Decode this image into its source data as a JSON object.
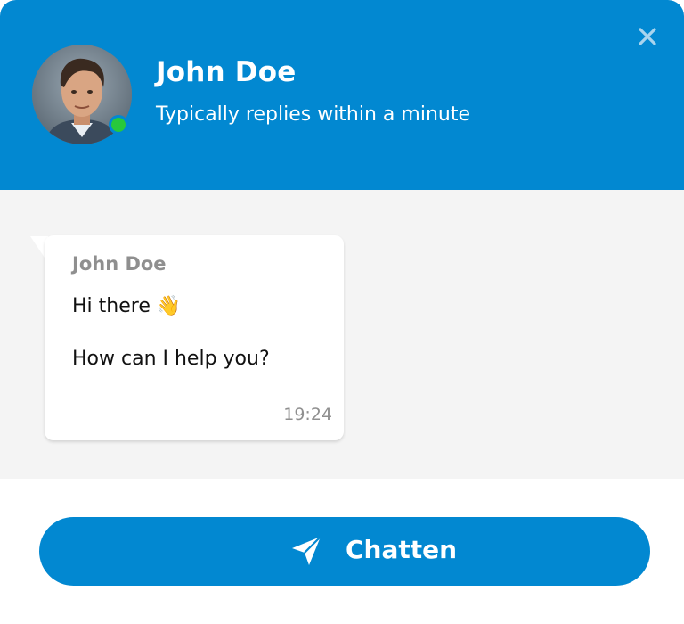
{
  "header": {
    "agent_name": "John Doe",
    "agent_status": "Typically replies within a minute",
    "online": true,
    "avatar_icon": "user-avatar-photo",
    "close_icon": "close-icon"
  },
  "messages": [
    {
      "author": "John Doe",
      "line1": "Hi there 👋",
      "line2": "How can I help you?",
      "time": "19:24"
    }
  ],
  "footer": {
    "button_label": "Chatten",
    "button_icon": "send-icon"
  },
  "colors": {
    "brand": "#0288d1",
    "online": "#28c83c",
    "chat_background": "#f4f4f4",
    "muted_text": "#8f8f8f"
  }
}
